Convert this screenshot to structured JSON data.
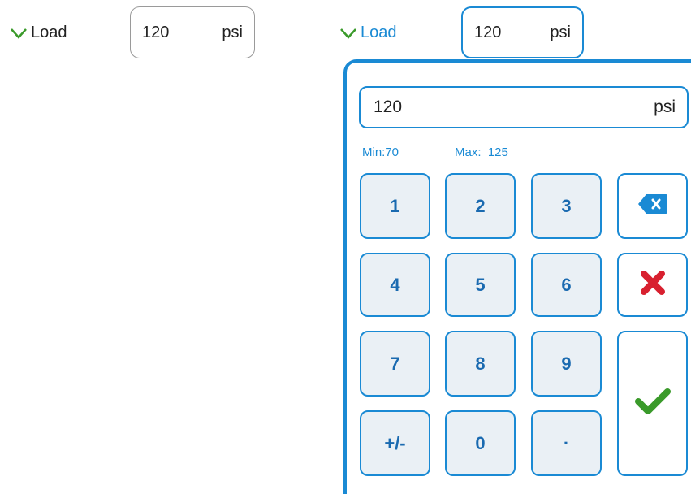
{
  "left_field": {
    "label": "Load",
    "value": "120",
    "unit": "psi"
  },
  "active_field": {
    "label": "Load",
    "value": "120",
    "unit": "psi"
  },
  "keypad": {
    "display_value": "120",
    "display_unit": "psi",
    "min_label": "Min:70",
    "max_label": "Max:  125",
    "keys": {
      "k1": "1",
      "k2": "2",
      "k3": "3",
      "k4": "4",
      "k5": "5",
      "k6": "6",
      "k7": "7",
      "k8": "8",
      "k9": "9",
      "sign": "+/-",
      "k0": "0",
      "dot": "·"
    },
    "icons": {
      "backspace": "backspace-icon",
      "clear": "close-icon",
      "enter": "check-icon"
    }
  },
  "colors": {
    "accent": "#1a8ad4",
    "key_bg": "#eaf0f5",
    "key_text": "#1a6ab0",
    "check_green": "#3a9a2a",
    "clear_red": "#d8202f"
  }
}
